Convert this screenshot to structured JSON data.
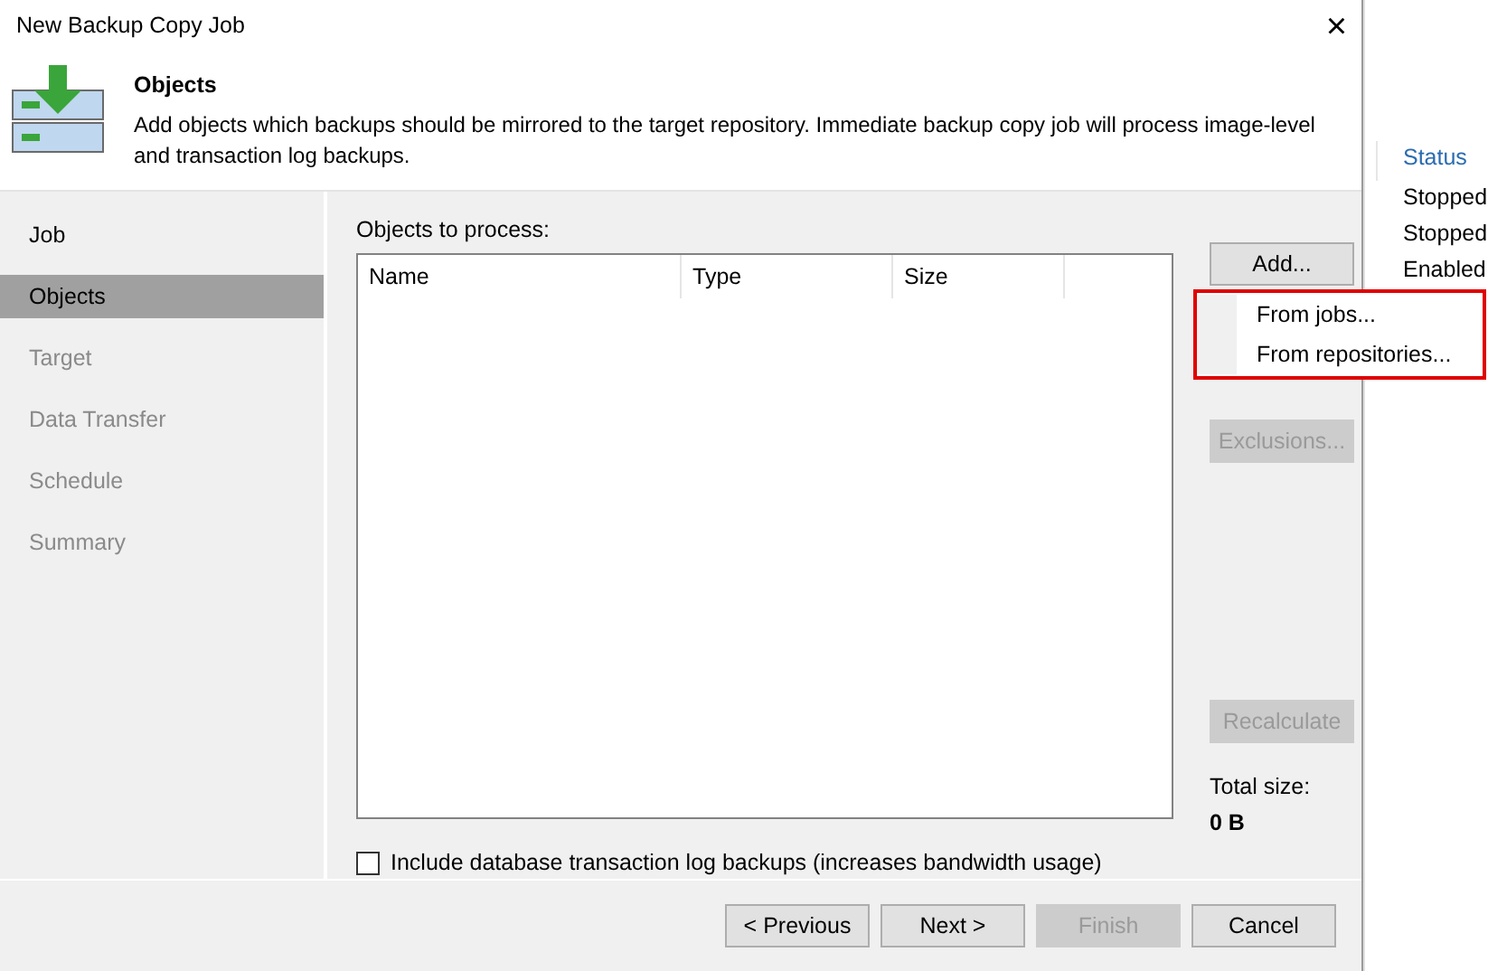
{
  "window": {
    "title": "New Backup Copy Job",
    "close": "×"
  },
  "header": {
    "title": "Objects",
    "description": "Add objects which backups should be mirrored to the target repository. Immediate backup copy job will process image-level and transaction log backups."
  },
  "steps": [
    {
      "label": "Job",
      "selected": false,
      "disabled": false
    },
    {
      "label": "Objects",
      "selected": true,
      "disabled": false
    },
    {
      "label": "Target",
      "selected": false,
      "disabled": true
    },
    {
      "label": "Data Transfer",
      "selected": false,
      "disabled": true
    },
    {
      "label": "Schedule",
      "selected": false,
      "disabled": true
    },
    {
      "label": "Summary",
      "selected": false,
      "disabled": true
    }
  ],
  "objects": {
    "label": "Objects to process:",
    "columns": [
      "Name",
      "Type",
      "Size"
    ]
  },
  "side_buttons": [
    {
      "label": "Add...",
      "disabled": false
    },
    {
      "label": "Exclusions...",
      "disabled": true
    },
    {
      "label": "Recalculate",
      "disabled": true
    }
  ],
  "add_menu": [
    {
      "label": "From jobs..."
    },
    {
      "label": "From repositories..."
    }
  ],
  "total": {
    "label": "Total size:",
    "value": "0 B"
  },
  "include_logs": {
    "label": "Include database transaction log backups (increases bandwidth usage)",
    "checked": false
  },
  "footer_buttons": [
    {
      "label": "< Previous",
      "disabled": false
    },
    {
      "label": "Next >",
      "disabled": false
    },
    {
      "label": "Finish",
      "disabled": true
    },
    {
      "label": "Cancel",
      "disabled": false
    }
  ],
  "background": {
    "column": "Status",
    "rows": [
      "Stopped",
      "Stopped",
      "Enabled"
    ]
  }
}
